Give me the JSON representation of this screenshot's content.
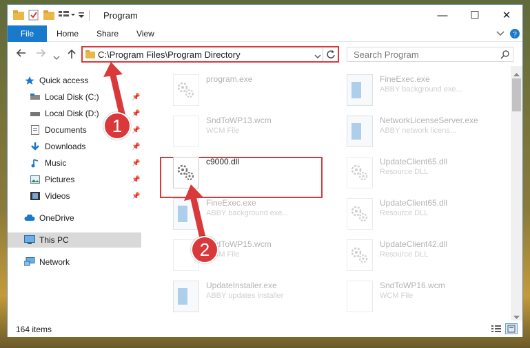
{
  "window": {
    "title": "Program",
    "minimize_glyph": "—",
    "maximize_glyph": "☐",
    "close_glyph": "✕"
  },
  "ribbon": {
    "tabs": [
      "File",
      "Home",
      "Share",
      "View"
    ]
  },
  "address": {
    "path": "C:\\Program Files\\Program Directory",
    "search_placeholder": "Search Program"
  },
  "nav": {
    "quick_access": "Quick access",
    "items": [
      {
        "label": "Local Disk (C:)",
        "icon": "drive-icon"
      },
      {
        "label": "Local Disk (D:)",
        "icon": "drive-icon"
      },
      {
        "label": "Documents",
        "icon": "documents-icon"
      },
      {
        "label": "Downloads",
        "icon": "downloads-icon"
      },
      {
        "label": "Music",
        "icon": "music-icon"
      },
      {
        "label": "Pictures",
        "icon": "pictures-icon"
      },
      {
        "label": "Videos",
        "icon": "videos-icon"
      }
    ],
    "onedrive": "OneDrive",
    "this_pc": "This PC",
    "network": "Network"
  },
  "files": [
    {
      "name": "program.exe",
      "desc": "",
      "type": "exe-gear"
    },
    {
      "name": "FineExec.exe",
      "desc": "ABBY background exe...",
      "type": "exe"
    },
    {
      "name": "SndToWP13.wcm",
      "desc": "WCM File",
      "type": "doc"
    },
    {
      "name": "NetworkLicenseServer.exe",
      "desc": "ABBY network licens...",
      "type": "exe"
    },
    {
      "name": "c9000.dll",
      "desc": "",
      "type": "dll"
    },
    {
      "name": "UpdateClient65.dll",
      "desc": "Resource DLL",
      "type": "dll"
    },
    {
      "name": "FineExec.exe",
      "desc": "ABBY background exe...",
      "type": "exe"
    },
    {
      "name": "UpdateClient65.dll",
      "desc": "Resource DLL",
      "type": "dll"
    },
    {
      "name": "SndToWP15.wcm",
      "desc": "WCM File",
      "type": "doc"
    },
    {
      "name": "UpdateClient42.dll",
      "desc": "Resource DLL",
      "type": "dll"
    },
    {
      "name": "UpdateInstaller.exe",
      "desc": "ABBY updates installer",
      "type": "exe"
    },
    {
      "name": "SndToWP16.wcm",
      "desc": "WCM File",
      "type": "doc"
    }
  ],
  "status": {
    "item_count": "164 items"
  },
  "callouts": {
    "step1": "1",
    "step2": "2"
  },
  "colors": {
    "accent": "#1979ca",
    "highlight": "#d9393b"
  }
}
